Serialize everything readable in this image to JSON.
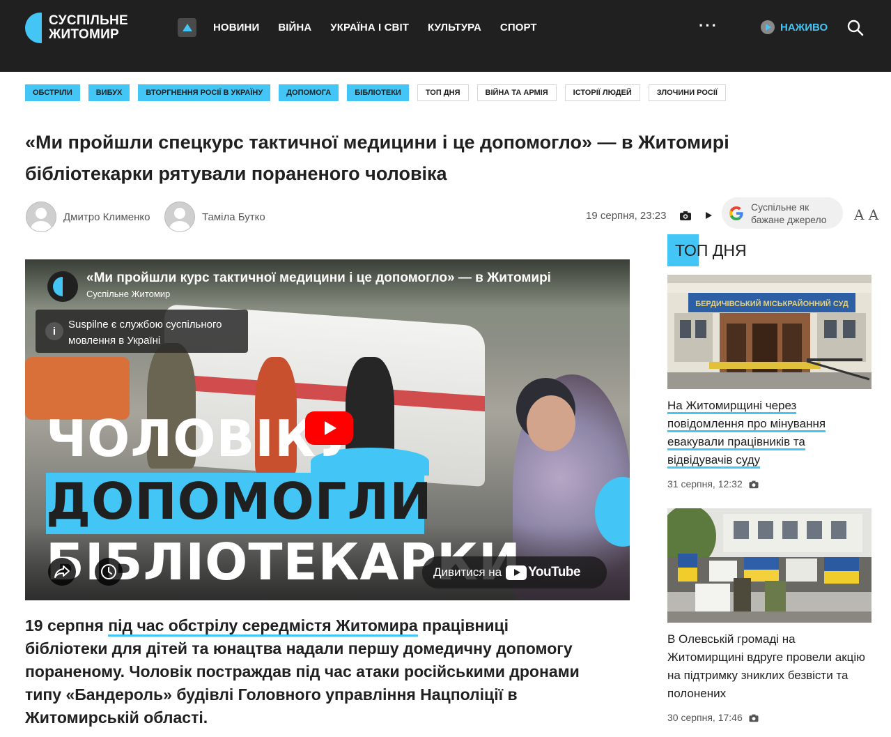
{
  "header": {
    "logo_line1": "СУСПІЛЬНЕ",
    "logo_line2": "ЖИТОМИР",
    "nav": [
      "НОВИНИ",
      "ВІЙНА",
      "УКРАЇНА І СВІТ",
      "КУЛЬТУРА",
      "СПОРТ"
    ],
    "more": "···",
    "live_label": "НАЖИВО",
    "accent_color": "#43c6f5",
    "background_color": "#202020"
  },
  "tags": [
    {
      "label": "ОБСТРІЛИ",
      "style": "blue"
    },
    {
      "label": "ВИБУХ",
      "style": "blue"
    },
    {
      "label": "ВТОРГНЕННЯ РОСІЇ В УКРАЇНУ",
      "style": "blue"
    },
    {
      "label": "ДОПОМОГА",
      "style": "blue"
    },
    {
      "label": "БІБЛІОТЕКИ",
      "style": "blue"
    },
    {
      "label": "ТОП ДНЯ",
      "style": "outline"
    },
    {
      "label": "ВІЙНА ТА АРМІЯ",
      "style": "outline"
    },
    {
      "label": "ІСТОРІЇ ЛЮДЕЙ",
      "style": "outline"
    },
    {
      "label": "ЗЛОЧИНИ РОСІЇ",
      "style": "outline"
    }
  ],
  "article": {
    "title": "«Ми пройшли спецкурс тактичної медицини і це допомогло» — в Житомирі бібліотекарки рятували пораненого чоловіка",
    "authors": [
      "Дмитро Клименко",
      "Таміла Бутко"
    ],
    "date": "19 серпня, 23:23",
    "google_source_line1": "Суспільне як",
    "google_source_line2": "бажане джерело",
    "font_size_icon": "A A",
    "lead_start": "19 серпня ",
    "lead_link": "під час обстрілу середмістя Житомира",
    "lead_rest": " працівниці бібліотеки для дітей та юнацтва надали першу домедичну допомогу пораненому. Чоловік постраждав під час атаки російськими дронами типу «Бандероль» будівлі Головного управління Нацполіції в Житомирській області."
  },
  "video": {
    "title": "«Ми пройшли курс тактичної медицини і це допомогло» — в Житомирі",
    "channel": "Суспільне Житомир",
    "info_text": "Suspilne є службою суспільного мовлення в Україні",
    "overlay_line1": "ЧОЛОВІКУ",
    "overlay_line2": "ДОПОМОГЛИ",
    "overlay_line3": "БІБЛІОТЕКАРКИ",
    "watch_on": "Дивитися на",
    "youtube": "YouTube"
  },
  "sidebar": {
    "heading": "ТОП ДНЯ",
    "items": [
      {
        "image_caption": "БЕРДИЧІВСЬКИЙ МІСЬКРАЙОННИЙ СУД",
        "title_underlined": "На Житомирщині через повідомлення про мінування евакували працівників та відвідувачів суду",
        "date": "31 серпня, 12:32"
      },
      {
        "image_caption": "",
        "title": "В Олевській громаді на Житомирщині вдруге провели акцію на підтримку зниклих безвісти та полонених",
        "date": "30 серпня, 17:46"
      }
    ]
  }
}
